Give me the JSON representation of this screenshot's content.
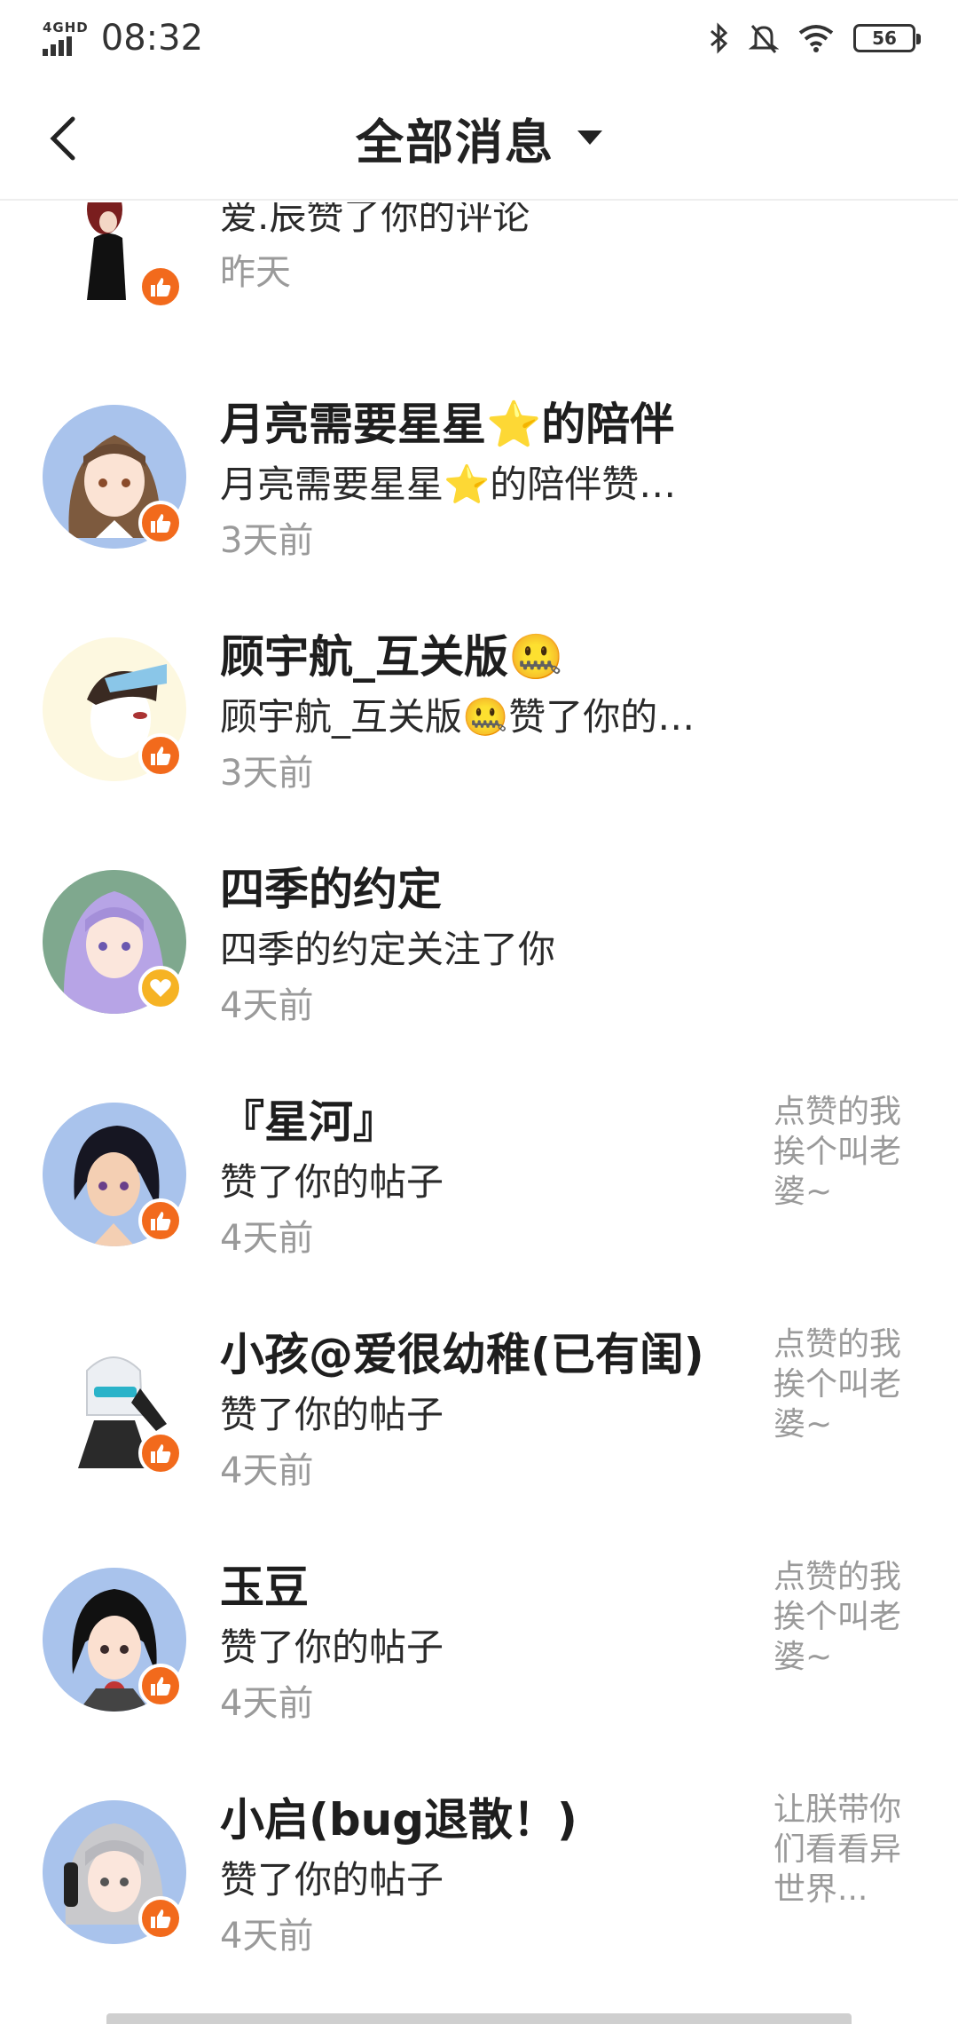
{
  "status": {
    "time": "08:32",
    "network": "4GHD",
    "battery": "56"
  },
  "header": {
    "title": "全部消息"
  },
  "messages": [
    {
      "name": "",
      "desc": "爱.辰赞了你的评论",
      "time": "昨天",
      "badge": "like",
      "note": ""
    },
    {
      "name": "月亮需要星星⭐的陪伴",
      "desc": "月亮需要星星⭐的陪伴赞…",
      "time": "3天前",
      "badge": "like",
      "note": ""
    },
    {
      "name": "顾宇航_互关版🤐",
      "desc": "顾宇航_互关版🤐赞了你的…",
      "time": "3天前",
      "badge": "like",
      "note": ""
    },
    {
      "name": "四季的约定",
      "desc": "四季的约定关注了你",
      "time": "4天前",
      "badge": "follow",
      "note": ""
    },
    {
      "name": "『星河』",
      "desc": "赞了你的帖子",
      "time": "4天前",
      "badge": "like",
      "note": "点赞的我挨个叫老婆~"
    },
    {
      "name": "小孩@爱很幼稚(已有闺)",
      "desc": "赞了你的帖子",
      "time": "4天前",
      "badge": "like",
      "note": "点赞的我挨个叫老婆~"
    },
    {
      "name": "玉豆",
      "desc": "赞了你的帖子",
      "time": "4天前",
      "badge": "like",
      "note": "点赞的我挨个叫老婆~"
    },
    {
      "name": "小启(bug退散！)",
      "desc": "赞了你的帖子",
      "time": "4天前",
      "badge": "like",
      "note": "让朕带你们看看异世界..."
    }
  ],
  "colors": {
    "like_badge": "#f26a1c",
    "follow_badge": "#f6b324",
    "time_gray": "#9a9a9a"
  },
  "icons": {
    "back": "chevron-left-icon",
    "dropdown": "caret-down-icon",
    "like": "thumbs-up-icon",
    "follow": "heart-icon"
  }
}
